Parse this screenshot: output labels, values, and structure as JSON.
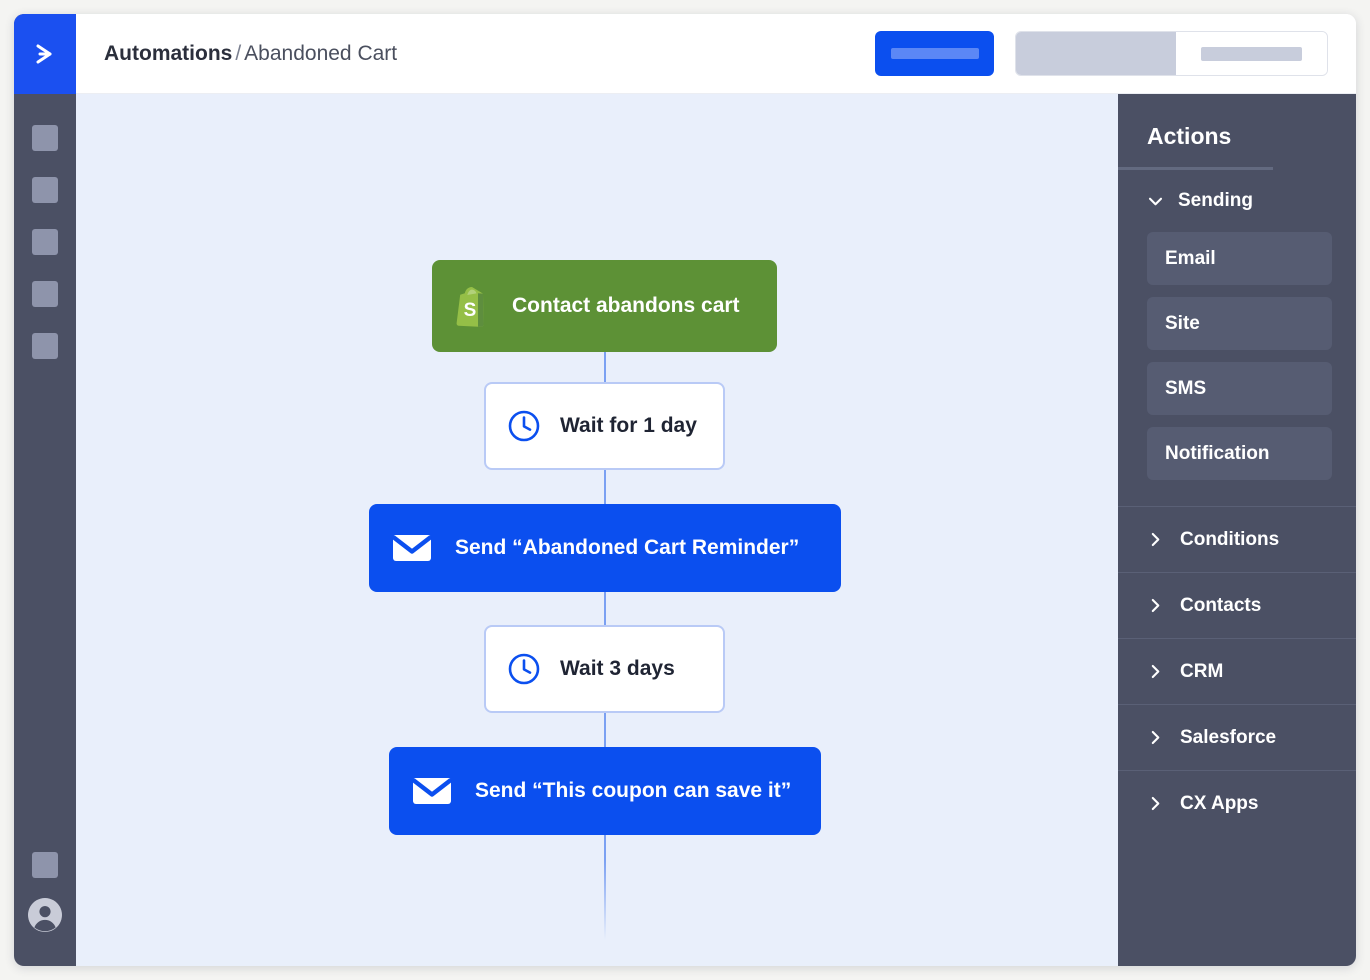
{
  "app": {
    "logo_icon": "chevron-right-logo-icon"
  },
  "topbar": {
    "breadcrumb_parent": "Automations",
    "breadcrumb_separator": "/",
    "breadcrumb_current": "Abandoned Cart",
    "primary_button_label": "",
    "segmented_control_label": ""
  },
  "sidebar": {
    "items": [
      {
        "name": "nav-placeholder-1"
      },
      {
        "name": "nav-placeholder-2"
      },
      {
        "name": "nav-placeholder-3"
      },
      {
        "name": "nav-placeholder-4"
      },
      {
        "name": "nav-placeholder-5"
      }
    ],
    "bottom": {
      "placeholder": {
        "name": "nav-placeholder-6"
      },
      "avatar_icon": "user-avatar-icon"
    }
  },
  "canvas": {
    "background_color": "#e9effb",
    "connector_color": "#7ba0f2",
    "nodes": [
      {
        "id": "trigger",
        "type": "trigger",
        "icon": "shopify-bag-icon",
        "label": "Contact abandons cart",
        "color": "#5d9136"
      },
      {
        "id": "wait-1",
        "type": "wait",
        "icon": "clock-icon",
        "label": "Wait for 1 day",
        "color": "#ffffff"
      },
      {
        "id": "send-1",
        "type": "send",
        "icon": "envelope-icon",
        "label": "Send “Abandoned Cart Reminder”",
        "color": "#0b4fef"
      },
      {
        "id": "wait-2",
        "type": "wait",
        "icon": "clock-icon",
        "label": "Wait 3 days",
        "color": "#ffffff"
      },
      {
        "id": "send-2",
        "type": "send",
        "icon": "envelope-icon",
        "label": "Send “This coupon can save it”",
        "color": "#0b4fef"
      }
    ]
  },
  "actions_panel": {
    "title": "Actions",
    "expanded_group": {
      "label": "Sending",
      "chevron_icon": "chevron-down-icon",
      "items": [
        {
          "label": "Email"
        },
        {
          "label": "Site"
        },
        {
          "label": "SMS"
        },
        {
          "label": "Notification"
        }
      ]
    },
    "collapsed_groups": [
      {
        "label": "Conditions",
        "chevron_icon": "chevron-right-icon"
      },
      {
        "label": "Contacts",
        "chevron_icon": "chevron-right-icon"
      },
      {
        "label": "CRM",
        "chevron_icon": "chevron-right-icon"
      },
      {
        "label": "Salesforce",
        "chevron_icon": "chevron-right-icon"
      },
      {
        "label": "CX Apps",
        "chevron_icon": "chevron-right-icon"
      }
    ]
  }
}
